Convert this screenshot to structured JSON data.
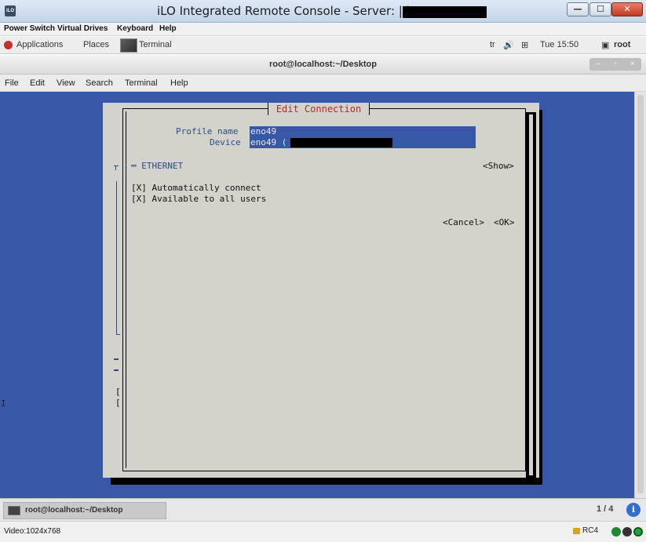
{
  "ilo_window": {
    "title": "iLO Integrated Remote Console - Server:  | iLO:",
    "logo": "iLO",
    "controls": {
      "minimize": "—",
      "maximize": "☐",
      "close": "✕"
    },
    "menu": [
      "Power Switch",
      "Virtual Drives",
      "Keyboard",
      "Help"
    ]
  },
  "gnome_panel": {
    "applications": "Applications",
    "places": "Places",
    "terminal_launcher": "Terminal",
    "keyboard_layout": "tr",
    "volume_icon": "🔊",
    "network_icon": "⊞",
    "clock": "Tue 15:50",
    "user_icon": "▣",
    "user": "root"
  },
  "terminal_window": {
    "title": "root@localhost:~/Desktop",
    "controls": {
      "minimize": "–",
      "maximize": "▫",
      "close": "×"
    },
    "menu": [
      "File",
      "Edit",
      "View",
      "Search",
      "Terminal",
      "Help"
    ],
    "left_cursor": "I"
  },
  "dialog": {
    "title": "Edit Connection",
    "profile_name_label": "Profile name",
    "profile_name_value": "eno49",
    "device_label": "Device",
    "device_value": "eno49 (",
    "ethernet_section": "═ ETHERNET",
    "show_button": "<Show>",
    "auto_connect": "[X] Automatically connect",
    "all_users": "[X] Available to all users",
    "cancel_button": "<Cancel>",
    "ok_button": "<OK>",
    "bracket_1": "[",
    "bracket_2": "["
  },
  "taskbar": {
    "task_label": "root@localhost:~/Desktop",
    "workspace": "1 / 4",
    "info_icon": "i"
  },
  "ilo_status": {
    "video": "Video:1024x768",
    "encryption": "RC4"
  },
  "colors": {
    "terminal_background": "#3658a7",
    "dialog_background": "#d3d3cb",
    "dialog_title": "#c2241b",
    "field_background": "#3658a7"
  }
}
